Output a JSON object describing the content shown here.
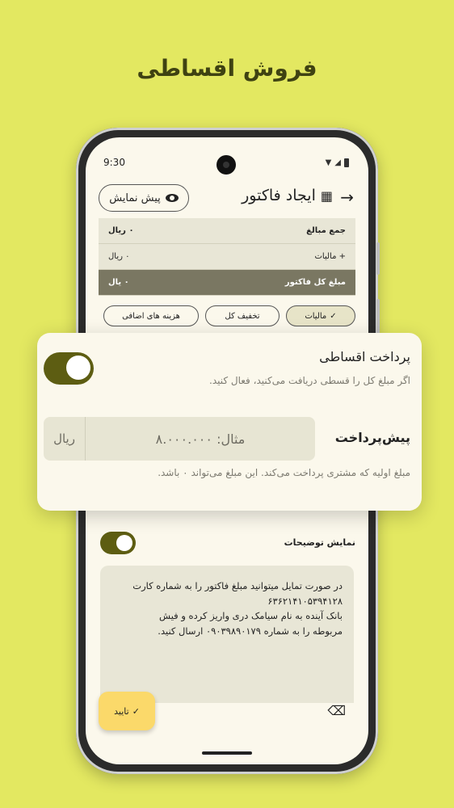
{
  "headline": "فروش اقساطی",
  "status": {
    "time": "9:30"
  },
  "app_bar": {
    "title": "ایجاد فاکتور",
    "preview_label": "پیش نمایش"
  },
  "summary": [
    {
      "label": "جمع مبالغ",
      "value": "۰ ریال"
    },
    {
      "label": "+ مالیات",
      "value": "۰ ریال"
    },
    {
      "label": "مبلغ کل فاکتور",
      "value": "۰ یال"
    }
  ],
  "chips": [
    {
      "label": "مالیات",
      "selected": true
    },
    {
      "label": "تخفیف کل",
      "selected": false
    },
    {
      "label": "هزینه های اضافی",
      "selected": false
    }
  ],
  "installment_card": {
    "title": "پرداخت اقساطی",
    "subtitle": "اگر مبلغ کل را قسطی دریافت می‌کنید، فعال کنید.",
    "toggle_on": true,
    "down_payment_label": "پیش‌پرداخت",
    "down_payment_placeholder": "مثال: ۸.۰۰۰.۰۰۰",
    "currency": "ریال",
    "down_payment_help": "مبلغ اولیه که مشتری پرداخت می‌کند. این مبلغ می‌تواند ۰ باشد."
  },
  "description": {
    "label": "نمایش توضیحات",
    "toggle_on": true,
    "lines": [
      "در صورت تمایل میتوانید مبلغ فاکتور را به شماره کارت",
      "۶۳۶۲۱۴۱۰۵۳۹۴۱۲۸",
      "بانک آینده به نام سیامک دری واریز کرده و فیش",
      "مربوطه را به شماره ۰۹۰۳۹۸۹۰۱۷۹ ارسال کنید."
    ]
  },
  "bottom": {
    "confirm_label": "تایید"
  },
  "colors": {
    "background": "#e3e861",
    "accent": "#5d5d12",
    "confirm": "#fbd96a"
  }
}
